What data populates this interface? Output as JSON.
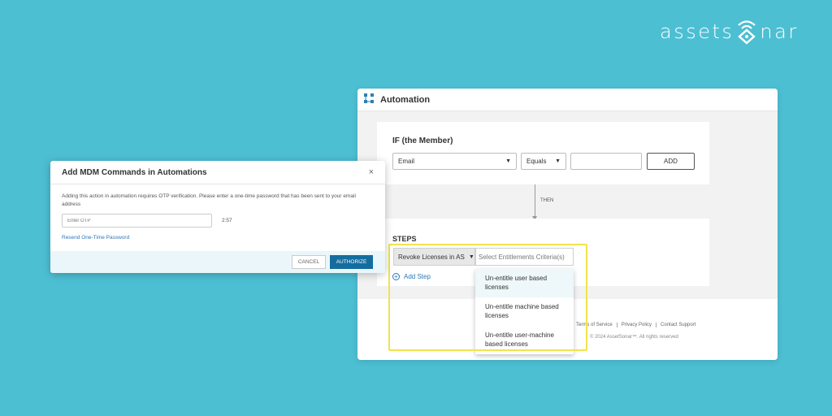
{
  "brand": {
    "logo_left": "assets",
    "logo_right": "nar"
  },
  "automation": {
    "title": "Automation",
    "if_label": "IF (the Member)",
    "field_select": "Email",
    "operator_select": "Equals",
    "value_input": "",
    "add_label": "ADD",
    "then_label": "THEN",
    "steps_label": "STEPS",
    "action_select": "Revoke Licenses in AS",
    "criteria_placeholder": "Select Entitlements Criteria(s)",
    "add_step_label": "Add Step",
    "dropdown_options": [
      "Un-entitle user based licenses",
      "Un-entitle machine based licenses",
      "Un-entitle user-machine based licenses"
    ],
    "footer_links": [
      "Terms of Service",
      "Privacy Policy",
      "Contact Support"
    ],
    "copyright": "© 2024 AssetSonar™. All rights reserved"
  },
  "modal": {
    "title": "Add MDM Commands in Automations",
    "close": "×",
    "description": "Adding this action in automation requires OTP verification. Please enter a one-time password that has been sent to your email address",
    "otp_placeholder": "Enter OTP",
    "timer": "2:57",
    "resend_label": "Resend One-Time Password",
    "cancel_label": "CANCEL",
    "authorize_label": "AUTHORIZE"
  },
  "colors": {
    "background": "#4dbfd3",
    "accent": "#146d9e",
    "link": "#2b77b8",
    "highlight": "#f0e44c"
  },
  "icons": {
    "automation": "automation-nodes-icon",
    "logo": "wifi-sonar-icon",
    "add_step": "plus-circle-icon",
    "close": "close-icon"
  }
}
